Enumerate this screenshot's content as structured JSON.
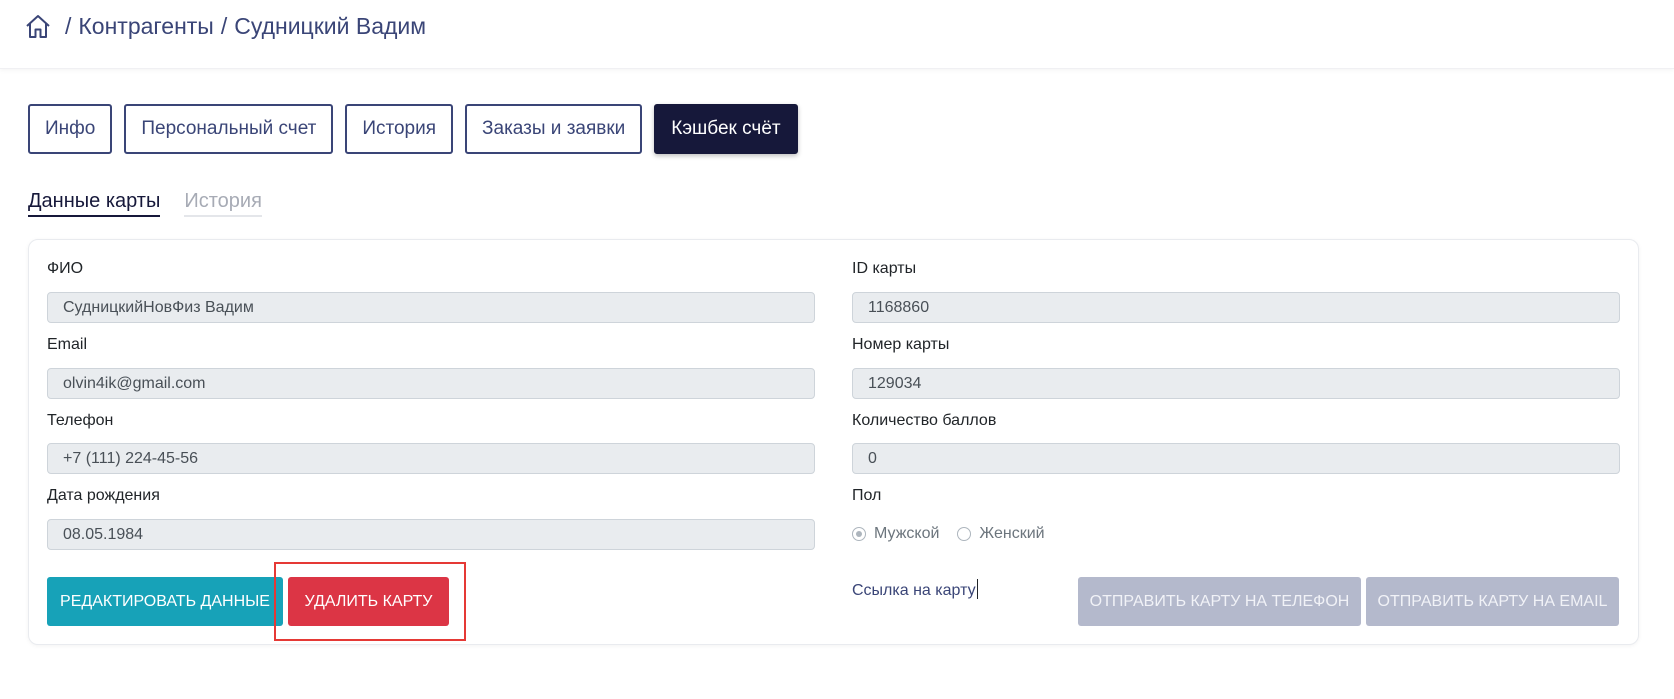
{
  "breadcrumb": {
    "home_icon": "home-icon",
    "separator": "/",
    "items": [
      "Контрагенты",
      "Судницкий Вадим"
    ]
  },
  "tabs": [
    {
      "label": "Инфо",
      "active": false
    },
    {
      "label": "Персональный счет",
      "active": false
    },
    {
      "label": "История",
      "active": false
    },
    {
      "label": "Заказы и заявки",
      "active": false
    },
    {
      "label": "Кэшбек счёт",
      "active": true
    }
  ],
  "subtabs": [
    {
      "label": "Данные карты",
      "active": true
    },
    {
      "label": "История",
      "active": false
    }
  ],
  "form": {
    "fio_label": "ФИО",
    "fio_value": "СудницкийНовФиз Вадим",
    "email_label": "Email",
    "email_value": "olvin4ik@gmail.com",
    "phone_label": "Телефон",
    "phone_value": "+7 (111) 224-45-56",
    "birth_label": "Дата рождения",
    "birth_value": "08.05.1984",
    "card_id_label": "ID карты",
    "card_id_value": "1168860",
    "card_number_label": "Номер карты",
    "card_number_value": "129034",
    "points_label": "Количество баллов",
    "points_value": "0",
    "gender_label": "Пол",
    "gender_options": [
      "Мужской",
      "Женский"
    ],
    "gender_selected": "Мужской"
  },
  "buttons": {
    "edit": "РЕДАКТИРОВАТЬ ДАННЫЕ",
    "delete": "УДАЛИТЬ КАРТУ",
    "send_phone": "ОТПРАВИТЬ КАРТУ НА ТЕЛЕФОН",
    "send_email": "ОТПРАВИТЬ КАРТУ НА EMAIL"
  },
  "card_link": "Ссылка на карту",
  "colors": {
    "primary": "#3a4577",
    "active_tab": "#16183a",
    "teal": "#17a2b8",
    "danger": "#dc3545",
    "disabled": "#b4b9cc",
    "highlight": "#e53935"
  }
}
